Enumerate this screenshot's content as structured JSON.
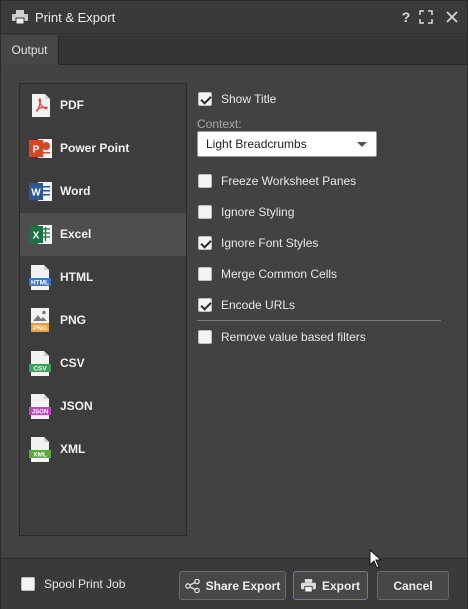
{
  "window": {
    "title": "Print & Export",
    "help_glyph": "?",
    "maximize_glyph": "⛶",
    "close_glyph": "✕"
  },
  "tabs": [
    {
      "label": "Output"
    }
  ],
  "formats": [
    {
      "label": "PDF",
      "icon": "pdf-icon",
      "color": "#e0463c"
    },
    {
      "label": "Power Point",
      "icon": "powerpoint-icon",
      "color": "#d24726"
    },
    {
      "label": "Word",
      "icon": "word-icon",
      "color": "#2b5797"
    },
    {
      "label": "Excel",
      "icon": "excel-icon",
      "color": "#1e7145",
      "selected": true
    },
    {
      "label": "HTML",
      "icon": "html-icon",
      "color": "#3b78c3",
      "badge": "HTML"
    },
    {
      "label": "PNG",
      "icon": "png-icon",
      "color": "#f0a22e",
      "badge": "PNG"
    },
    {
      "label": "CSV",
      "icon": "csv-icon",
      "color": "#3aa15a",
      "badge": "CSV"
    },
    {
      "label": "JSON",
      "icon": "json-icon",
      "color": "#c044c0",
      "badge": "JSON"
    },
    {
      "label": "XML",
      "icon": "xml-icon",
      "color": "#58a83a",
      "badge": "XML"
    }
  ],
  "options": {
    "show_title": {
      "label": "Show Title",
      "checked": true
    },
    "context_label": "Context:",
    "context_value": "Light Breadcrumbs",
    "freeze_panes": {
      "label": "Freeze Worksheet Panes",
      "checked": false
    },
    "ignore_styling": {
      "label": "Ignore Styling",
      "checked": false
    },
    "ignore_font_styles": {
      "label": "Ignore Font Styles",
      "checked": true
    },
    "merge_cells": {
      "label": "Merge Common Cells",
      "checked": false
    },
    "encode_urls": {
      "label": "Encode URLs",
      "checked": true
    },
    "remove_filters": {
      "label": "Remove value based filters",
      "checked": false
    }
  },
  "footer": {
    "spool": {
      "label": "Spool Print Job",
      "checked": false
    },
    "share_label": "Share Export",
    "export_label": "Export",
    "cancel_label": "Cancel"
  }
}
